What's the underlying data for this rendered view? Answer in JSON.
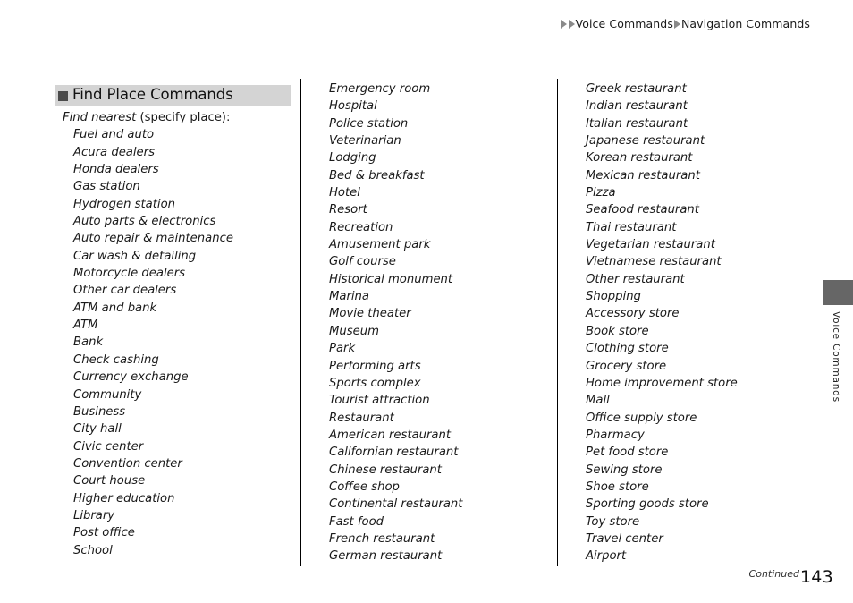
{
  "breadcrumb": {
    "level1": "Voice Commands",
    "level2": "Navigation Commands"
  },
  "section": {
    "title": "Find Place Commands",
    "lead_italic": "Find nearest",
    "lead_roman": " (specify place):"
  },
  "columns": [
    {
      "id": "column-1",
      "items": [
        "Fuel and auto",
        "Acura dealers",
        "Honda dealers",
        "Gas station",
        "Hydrogen station",
        "Auto parts & electronics",
        "Auto repair & maintenance",
        "Car wash & detailing",
        "Motorcycle dealers",
        "Other car dealers",
        "ATM and bank",
        "ATM",
        "Bank",
        "Check cashing",
        "Currency exchange",
        "Community",
        "Business",
        "City hall",
        "Civic center",
        "Convention center",
        "Court house",
        "Higher education",
        "Library",
        "Post office",
        "School"
      ]
    },
    {
      "id": "column-2",
      "items": [
        "Emergency room",
        "Hospital",
        "Police station",
        "Veterinarian",
        "Lodging",
        "Bed & breakfast",
        "Hotel",
        "Resort",
        "Recreation",
        "Amusement park",
        "Golf course",
        "Historical monument",
        "Marina",
        "Movie theater",
        "Museum",
        "Park",
        "Performing arts",
        "Sports complex",
        "Tourist attraction",
        "Restaurant",
        "American restaurant",
        "Californian restaurant",
        "Chinese restaurant",
        "Coffee shop",
        "Continental restaurant",
        "Fast food",
        "French restaurant",
        "German restaurant"
      ]
    },
    {
      "id": "column-3",
      "items": [
        "Greek restaurant",
        "Indian restaurant",
        "Italian restaurant",
        "Japanese restaurant",
        "Korean restaurant",
        "Mexican restaurant",
        "Pizza",
        "Seafood restaurant",
        "Thai restaurant",
        "Vegetarian restaurant",
        "Vietnamese restaurant",
        "Other restaurant",
        "Shopping",
        "Accessory store",
        "Book store",
        "Clothing store",
        "Grocery store",
        "Home improvement store",
        "Mall",
        "Office supply store",
        "Pharmacy",
        "Pet food store",
        "Sewing store",
        "Shoe store",
        "Sporting goods store",
        "Toy store",
        "Travel center",
        "Airport"
      ]
    }
  ],
  "side_tab": {
    "label": "Voice Commands"
  },
  "footer": {
    "continued": "Continued",
    "page_number": "143"
  },
  "colors": {
    "section_bar_bg": "#d4d4d4",
    "section_square": "#4a4a4a",
    "side_tab": "#666666",
    "triangle": "#8a8a8a"
  }
}
